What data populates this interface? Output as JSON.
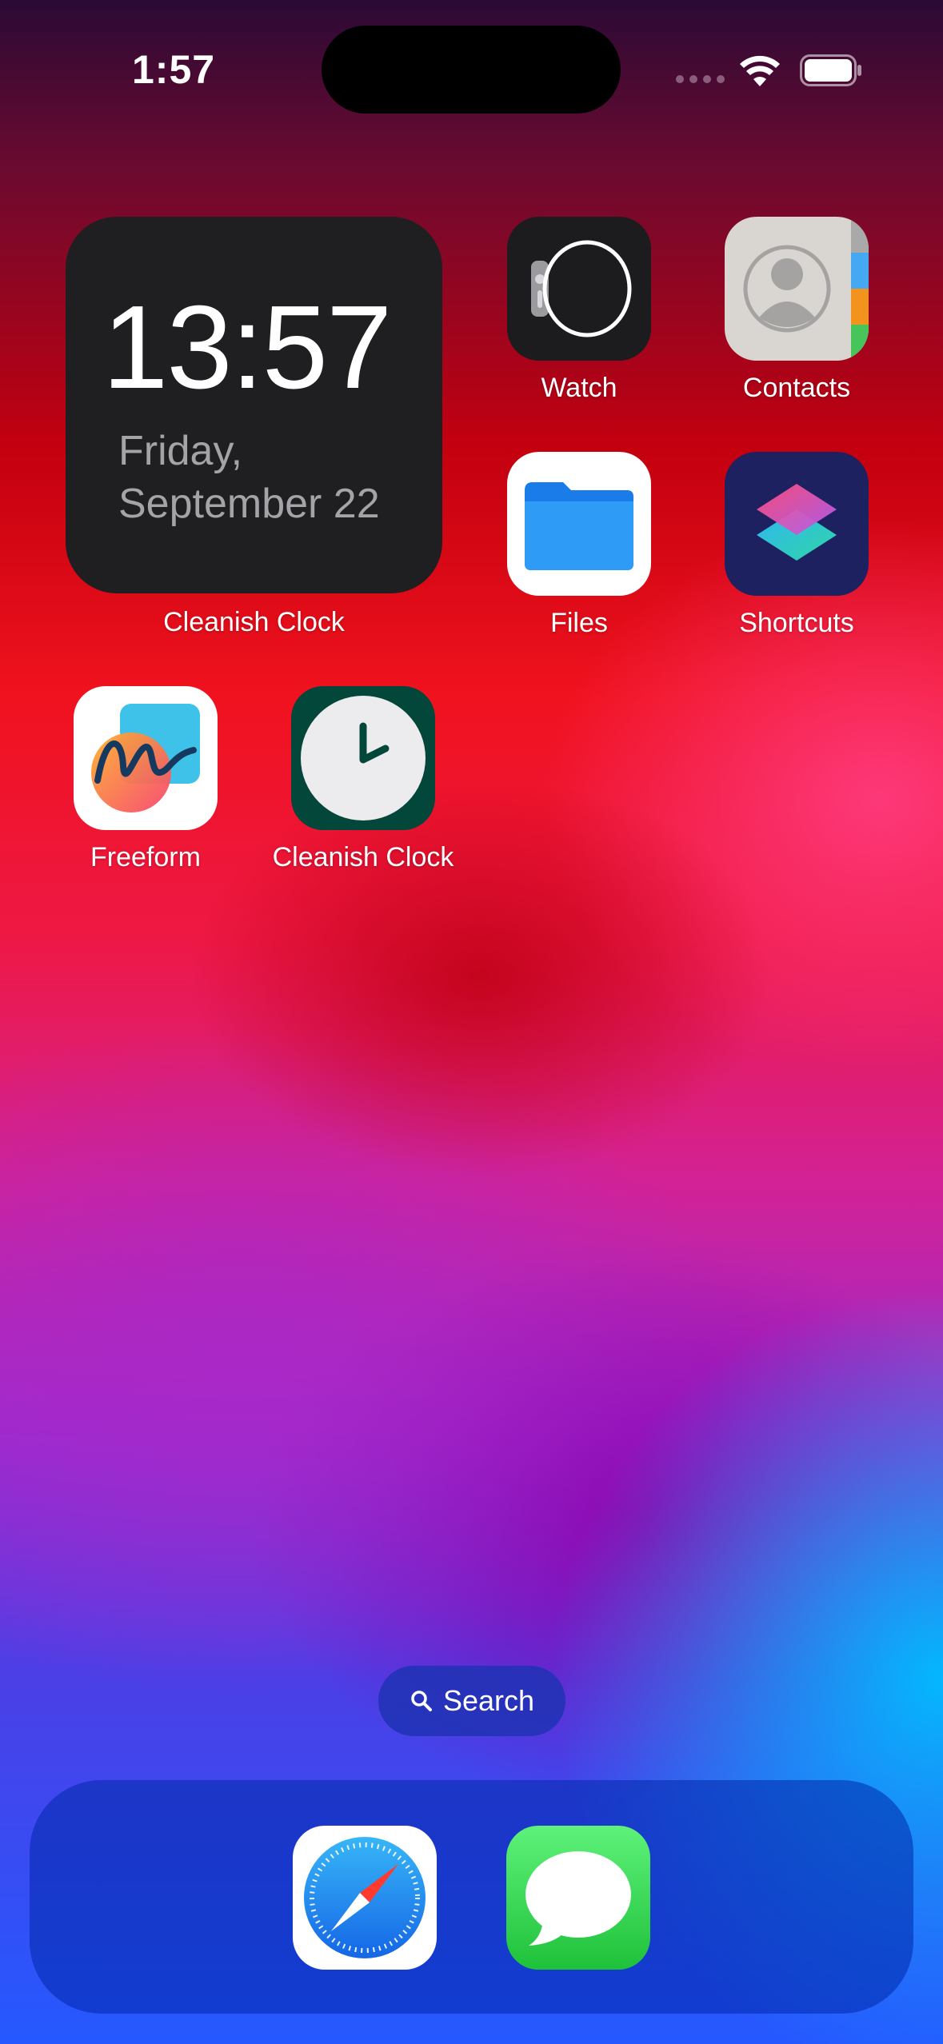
{
  "status_bar": {
    "time": "1:57",
    "icons": [
      "cellular-signal-icon",
      "wifi-icon",
      "battery-icon"
    ]
  },
  "widget": {
    "time": "13:57",
    "date_line1": "Friday,",
    "date_line2": "September 22",
    "label": "Cleanish Clock"
  },
  "apps": {
    "watch": {
      "label": "Watch",
      "icon": "watch-icon"
    },
    "contacts": {
      "label": "Contacts",
      "icon": "contacts-icon"
    },
    "files": {
      "label": "Files",
      "icon": "files-folder-icon"
    },
    "shortcuts": {
      "label": "Shortcuts",
      "icon": "shortcuts-icon"
    },
    "freeform": {
      "label": "Freeform",
      "icon": "freeform-icon"
    },
    "clock": {
      "label": "Cleanish Clock",
      "icon": "clock-icon"
    }
  },
  "search": {
    "label": "Search",
    "icon": "search-icon"
  },
  "dock": {
    "items": [
      {
        "name": "Safari",
        "icon": "safari-compass-icon"
      },
      {
        "name": "Messages",
        "icon": "messages-bubble-icon"
      }
    ]
  },
  "colors": {
    "widget_bg": "#1f1f21",
    "widget_date": "#a3a3a8",
    "clock_icon_bg": "#03463a",
    "shortcuts_bg": "#1d2160",
    "messages_green": "#2fd34f",
    "safari_blue": "#1d8ef5"
  }
}
